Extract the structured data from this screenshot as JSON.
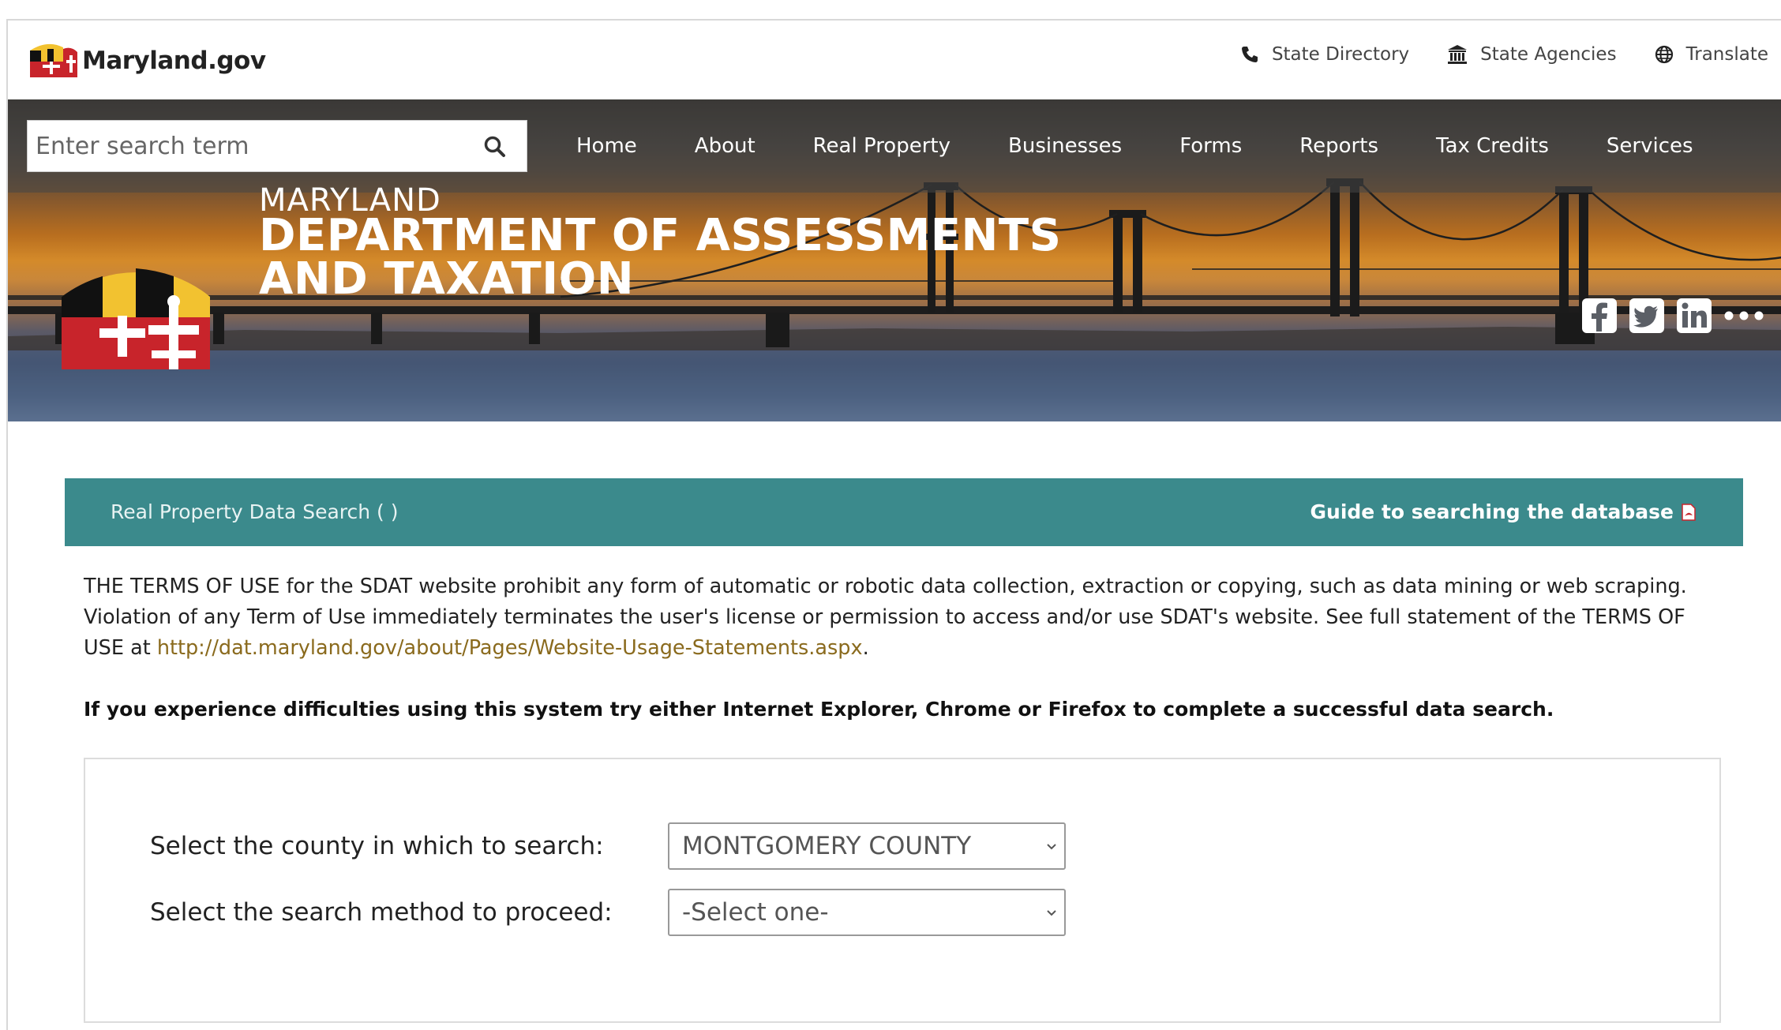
{
  "site": {
    "logo_text": "Maryland.gov"
  },
  "utility_links": [
    {
      "label": "State Directory",
      "icon": "phone-icon"
    },
    {
      "label": "State Agencies",
      "icon": "building-icon"
    },
    {
      "label": "Translate",
      "icon": "globe-icon"
    }
  ],
  "search": {
    "placeholder": "Enter search term"
  },
  "nav": [
    "Home",
    "About",
    "Real Property",
    "Businesses",
    "Forms",
    "Reports",
    "Tax Credits",
    "Services"
  ],
  "hero": {
    "line1": "MARYLAND",
    "line2": "DEPARTMENT OF ASSESSMENTS",
    "line3": "AND TAXATION"
  },
  "social_icons": [
    "facebook-icon",
    "twitter-icon",
    "linkedin-icon",
    "more-icon"
  ],
  "banner": {
    "title": "Real Property Data Search ( )",
    "guide_link": "Guide to searching the database"
  },
  "terms": {
    "text": "THE TERMS OF USE for the SDAT website prohibit any form of automatic or robotic data collection, extraction or copying, such as data mining or web scraping. Violation of any Term of Use immediately terminates the user's license or permission to access and/or use SDAT's website. See full statement of the TERMS OF USE at ",
    "link": "http://dat.maryland.gov/about/Pages/Website-Usage-Statements.aspx",
    "end": "."
  },
  "notice": "If you experience difficulties using this system try either Internet Explorer, Chrome or Firefox to complete a successful data search.",
  "form": {
    "county_label": "Select the county in which to search:",
    "county_value": "MONTGOMERY COUNTY",
    "method_label": "Select the search method to proceed:",
    "method_value": "-Select one-"
  },
  "colors": {
    "banner_teal": "#3b8a8c",
    "link_gold": "#8a6a1d",
    "flag_red": "#c8242b",
    "flag_gold": "#f2c230"
  }
}
